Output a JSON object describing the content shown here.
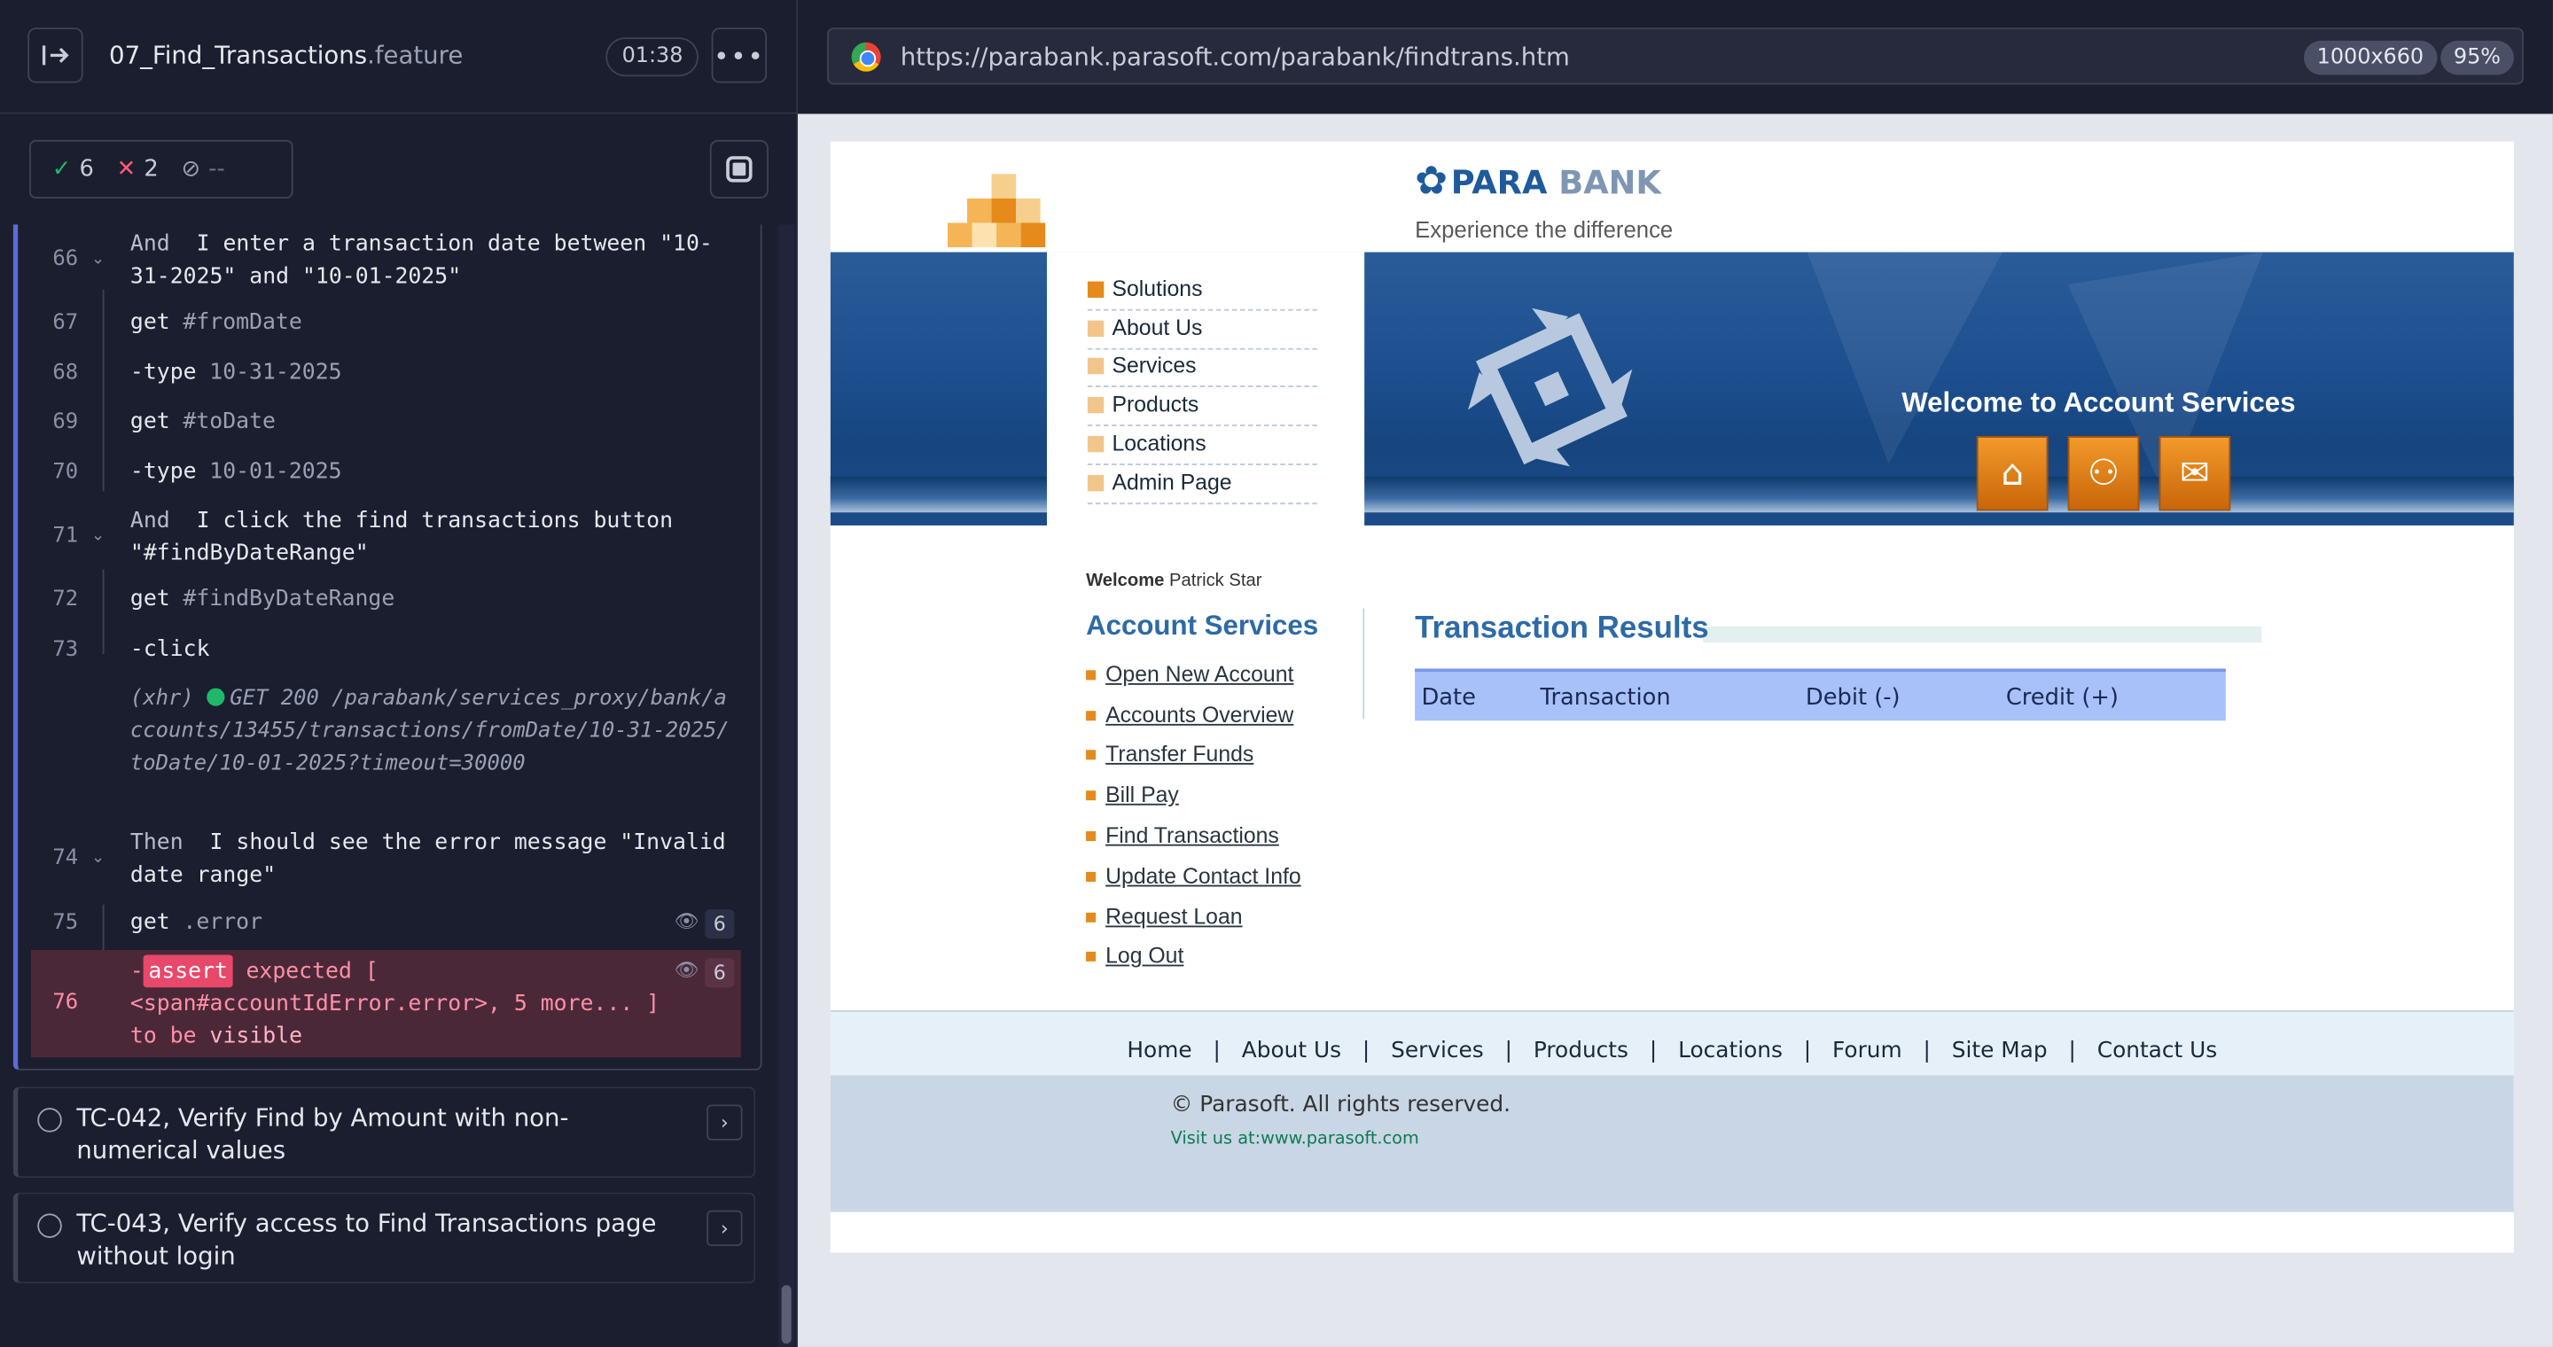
{
  "runner": {
    "feature_name": "07_Find_Transactions",
    "feature_ext": ".feature",
    "timer": "01:38",
    "stats": {
      "passed": "6",
      "failed": "2",
      "pending": "--"
    },
    "steps": [
      {
        "line": "66",
        "kw": "And",
        "text": "I enter a transaction date between \"10-31-2025\" and \"10-01-2025\""
      },
      {
        "line": "67",
        "cmd": "get",
        "arg": "#fromDate"
      },
      {
        "line": "68",
        "cmd": "-type",
        "arg": "10-31-2025"
      },
      {
        "line": "69",
        "cmd": "get",
        "arg": "#toDate"
      },
      {
        "line": "70",
        "cmd": "-type",
        "arg": "10-01-2025"
      },
      {
        "line": "71",
        "kw": "And",
        "text": "I click the find transactions button \"#findByDateRange\""
      },
      {
        "line": "72",
        "cmd": "get",
        "arg": "#findByDateRange"
      },
      {
        "line": "73",
        "cmd": "-click",
        "arg": ""
      },
      {
        "line": "74",
        "kw": "Then",
        "text": "I should see the error message \"Invalid date range\""
      },
      {
        "line": "75",
        "cmd": "get",
        "arg": ".error",
        "badge": "6"
      },
      {
        "line": "76",
        "badge": "6"
      }
    ],
    "xhr": {
      "prefix": "(xhr)",
      "status": "GET 200",
      "url": "/parabank/services_proxy/bank/accounts/13455/transactions/fromDate/10-31-2025/toDate/10-01-2025?timeout=30000"
    },
    "assert": {
      "dash": "-",
      "label": "assert",
      "expected": "expected",
      "bracket_open": "[",
      "subject": "<span#accountIdError.error>, 5 more... ]",
      "to_be": "to be",
      "visible": "visible"
    },
    "tests": [
      {
        "title": "TC-042, Verify Find by Amount with non-numerical values"
      },
      {
        "title": "TC-043, Verify access to Find Transactions page without login"
      }
    ]
  },
  "browser": {
    "url": "https://parabank.parasoft.com/parabank/findtrans.htm",
    "viewport": "1000x660",
    "zoom": "95%"
  },
  "parabank": {
    "logo_para": "PARA",
    "logo_bank": "BANK",
    "tagline": "Experience the difference",
    "menu": [
      "Solutions",
      "About Us",
      "Services",
      "Products",
      "Locations",
      "Admin Page"
    ],
    "banner_welcome": "Welcome to Account Services",
    "welcome_label": "Welcome",
    "welcome_user": "Patrick Star",
    "account_services_title": "Account Services",
    "account_links": [
      "Open New Account",
      "Accounts Overview",
      "Transfer Funds",
      "Bill Pay",
      "Find Transactions",
      "Update Contact Info",
      "Request Loan",
      "Log Out"
    ],
    "results_title": "Transaction Results",
    "table_headers": [
      "Date",
      "Transaction",
      "Debit (-)",
      "Credit (+)"
    ],
    "footer_links": [
      "Home",
      "About Us",
      "Services",
      "Products",
      "Locations",
      "Forum",
      "Site Map",
      "Contact Us"
    ],
    "copyright": "© Parasoft. All rights reserved.",
    "visit": "Visit us at:www.parasoft.com"
  },
  "colors": {
    "accent": "#5b6cd8",
    "error_bg": "#4b2838",
    "parabank_blue": "#2d6aa8",
    "orange": "#e58a1b"
  }
}
